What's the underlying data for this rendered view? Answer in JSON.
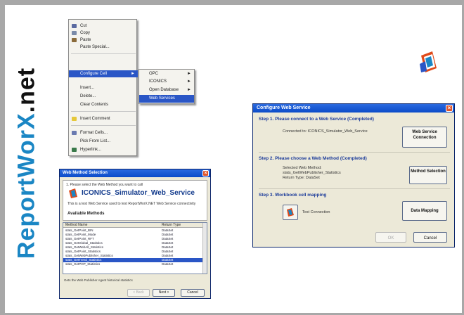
{
  "brand": {
    "text_main": "ReportWorX",
    "text_dot": ".net"
  },
  "context_menu": {
    "items": [
      {
        "label": "Cut",
        "icon": "scissors-icon"
      },
      {
        "label": "Copy",
        "icon": "copy-icon"
      },
      {
        "label": "Paste",
        "icon": "paste-icon"
      },
      {
        "label": "Paste Special...",
        "icon": ""
      },
      {
        "label": "Configure Cell",
        "icon": "",
        "highlighted": true
      },
      {
        "label": "Insert...",
        "icon": ""
      },
      {
        "label": "Delete...",
        "icon": ""
      },
      {
        "label": "Clear Contents",
        "icon": ""
      },
      {
        "label": "Insert Comment",
        "icon": "comment-icon"
      },
      {
        "label": "Format Cells...",
        "icon": "format-icon"
      },
      {
        "label": "Pick From List...",
        "icon": ""
      },
      {
        "label": "Hyperlink...",
        "icon": "hyperlink-icon"
      }
    ],
    "submenu": [
      {
        "label": "OPC"
      },
      {
        "label": "ICONICS"
      },
      {
        "label": "Open Database"
      },
      {
        "label": "Web Services",
        "highlighted": true
      }
    ]
  },
  "web_method_dialog": {
    "title": "Web Method Selection",
    "prompt": "1. Please select the Web Method you want to call",
    "service_name": "ICONICS_Simulator_Web_Service",
    "description": "This is a test Web Service used to test ReportWorX.NET Web Service connectivity",
    "available_label": "Available Methods",
    "columns": [
      "Method Name",
      "Return Type"
    ],
    "rows": [
      [
        "stats_GetPoint_BIN",
        "DataSet"
      ],
      [
        "stats_GetPoint_Mode",
        "DataSet"
      ],
      [
        "stats_GetPoint_RFT",
        "DataSet"
      ],
      [
        "stats_GetGlobal_Statistics",
        "DataSet"
      ],
      [
        "stats_GetWebAll_Statistics",
        "DataSet"
      ],
      [
        "stats_GetPoint_Statistics",
        "DataSet"
      ],
      [
        "stats_GetWebPublisher_Statistics",
        "DataSet"
      ],
      [
        "stats_GetTrend_Statistics",
        "DataSet"
      ],
      [
        "stats_GetPOP_Statistics",
        "DataSet"
      ]
    ],
    "selected_row": 7,
    "footer": "Gets the Web Publisher Agent historical statistics",
    "buttons": {
      "back": "< Back",
      "next": "Next >",
      "cancel": "Cancel"
    }
  },
  "configure_dialog": {
    "title": "Configure Web Service",
    "step1": {
      "heading": "Step 1. Please connect to a Web Service (Completed)",
      "info": "Connected to: ICONICS_Simulator_Web_Service",
      "button": "Web Service Connection"
    },
    "step2": {
      "heading": "Step 2. Please choose a Web Method (Completed)",
      "info_line1": "Selected Web Method:",
      "info_line2": "stats_GetWebPublisher_Statistics",
      "info_line3": "Return Type: DataSet",
      "button": "Method Selection"
    },
    "step3": {
      "heading": "Step 3. Workbook cell mapping",
      "info": "Test Connection",
      "button": "Data Mapping"
    },
    "buttons": {
      "ok": "OK",
      "cancel": "Cancel"
    }
  },
  "colors": {
    "brand_blue": "#1a86c4",
    "menu_highlight": "#2a56c6",
    "titlebar": "#0b4bc8"
  }
}
